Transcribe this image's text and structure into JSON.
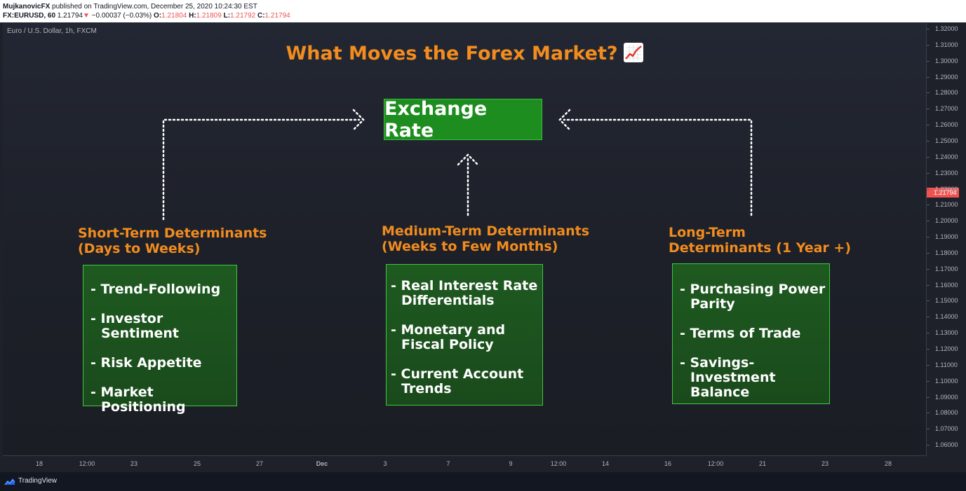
{
  "header": {
    "author": "MujkanovicFX",
    "published": "published on TradingView.com, December 25, 2020 10:24:30 EST",
    "symbol": "FX:EURUSD, 60",
    "last": "1.21794",
    "change_arrow": "▼",
    "change": "−0.00037 (−0.03%)",
    "open_label": "O:",
    "open": "1.21804",
    "high_label": "H:",
    "high": "1.21809",
    "low_label": "L:",
    "low": "1.21792",
    "close_label": "C:",
    "close": "1.21794"
  },
  "chart": {
    "series_label": "Euro / U.S. Dollar, 1h, FXCM",
    "title": "What Moves the Forex Market?",
    "title_icon": "chart-increasing-icon",
    "center_label": "Exchange Rate",
    "columns": [
      {
        "heading": "Short-Term Determinants\n(Days to Weeks)",
        "items": [
          "- Trend-Following",
          "- Investor Sentiment",
          "- Risk Appetite",
          "- Market Positioning"
        ]
      },
      {
        "heading": "Medium-Term Determinants\n(Weeks to Few Months)",
        "items": [
          "- Real Interest Rate Differentials",
          "- Monetary and Fiscal Policy",
          "- Current Account Trends"
        ]
      },
      {
        "heading": "Long-Term\nDeterminants (1 Year +)",
        "items": [
          "- Purchasing Power Parity",
          "- Terms of Trade",
          "- Savings-Investment Balance"
        ]
      }
    ],
    "colors": {
      "accent_orange": "#f28c1e",
      "box_green": "#1c8d1e",
      "box_border": "#3ec63f",
      "price_tag": "#ef5350"
    }
  },
  "price_axis": {
    "ticks": [
      "1.32000",
      "1.31000",
      "1.30000",
      "1.29000",
      "1.28000",
      "1.27000",
      "1.26000",
      "1.25000",
      "1.24000",
      "1.23000",
      "1.22000",
      "1.21000",
      "1.20000",
      "1.19000",
      "1.18000",
      "1.17000",
      "1.16000",
      "1.15000",
      "1.14000",
      "1.13000",
      "1.12000",
      "1.11000",
      "1.10000",
      "1.09000",
      "1.08000",
      "1.07000",
      "1.06000"
    ],
    "current_price": "1.21794"
  },
  "time_axis": {
    "ticks": [
      "18",
      "12:00",
      "23",
      "25",
      "27",
      "Dec",
      "3",
      "7",
      "9",
      "12:00",
      "14",
      "16",
      "12:00",
      "21",
      "23",
      "28"
    ]
  },
  "footer": {
    "brand": "TradingView",
    "logo_icon": "tradingview-logo-icon"
  }
}
